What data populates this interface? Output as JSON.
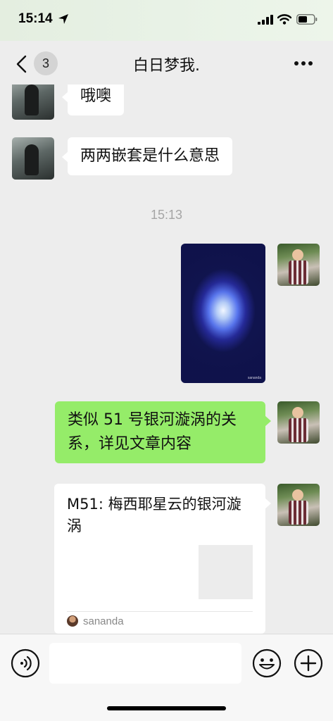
{
  "status_bar": {
    "time": "15:14"
  },
  "nav": {
    "unread_count": "3",
    "title": "白日梦我."
  },
  "messages": [
    {
      "side": "in",
      "text": "哦噢"
    },
    {
      "side": "in",
      "text": "两两嵌套是什么意思"
    },
    {
      "side": "out",
      "text": "类似 51 号银河漩涡的关系，详见文章内容"
    }
  ],
  "timestamp": "15:13",
  "image_message": {
    "watermark": "sananda"
  },
  "link_card": {
    "title": "M51: 梅西耶星云的银河漩涡",
    "source": "sananda"
  },
  "input": {
    "value": ""
  },
  "colors": {
    "outgoing_bubble": "#95ec69",
    "incoming_bubble": "#ffffff",
    "background": "#ededed"
  }
}
